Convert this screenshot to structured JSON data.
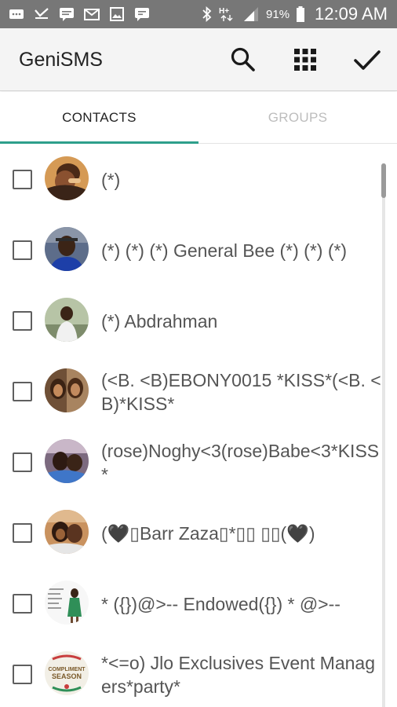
{
  "status_bar": {
    "battery_percent": "91%",
    "time": "12:09 AM",
    "left_icons": [
      "email-notification-icon",
      "missed-call-icon",
      "sms-notification-icon",
      "mail-icon",
      "photo-icon",
      "chat-notification-icon"
    ],
    "right_icons": [
      "bluetooth-icon",
      "hplus-network-icon",
      "signal-strength-icon",
      "battery-icon"
    ]
  },
  "app_bar": {
    "title": "GeniSMS",
    "actions": [
      "search-icon",
      "grid-icon",
      "check-icon"
    ]
  },
  "tabs": [
    {
      "label": "CONTACTS",
      "active": true
    },
    {
      "label": "GROUPS",
      "active": false
    }
  ],
  "accent_color": "#2e9f8b",
  "contacts": [
    {
      "name": "(*)",
      "checked": false
    },
    {
      "name": "(*) (*) (*) General Bee (*) (*) (*)",
      "checked": false
    },
    {
      "name": "(*) Abdrahman",
      "checked": false
    },
    {
      "name": "(<B. <B)EBONY0015 *KISS*(<B. <B)*KISS*",
      "checked": false
    },
    {
      "name": "(rose)Noghy<3(rose)Babe<3*KISS*",
      "checked": false
    },
    {
      "name": "(🖤▯Barr Zaza▯*▯▯ ▯▯(🖤)",
      "checked": false
    },
    {
      "name": "* ({})@>-- Endowed({}) * @>--",
      "checked": false
    },
    {
      "name": "*<=o) Jlo Exclusives Event Managers*party*",
      "checked": false
    }
  ],
  "avatar_logo_text": {
    "compliment": "COMPLIMENT",
    "season": "SEASON"
  }
}
